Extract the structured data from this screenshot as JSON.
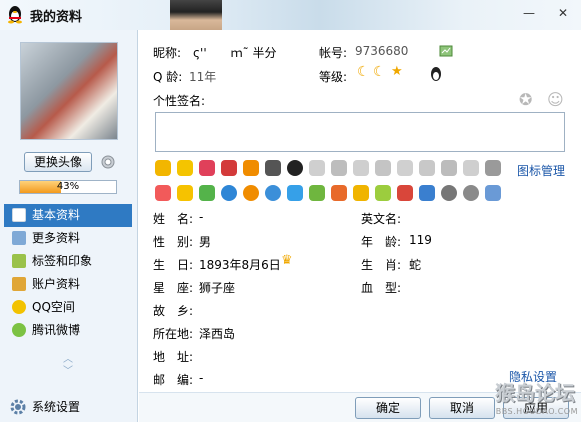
{
  "window": {
    "title": "我的资料",
    "minimize_glyph": "—",
    "close_glyph": "✕"
  },
  "profile": {
    "change_avatar_label": "更换头像",
    "completion_progress": 0.43,
    "completion_text": "43%"
  },
  "sidebar": {
    "items": [
      {
        "label": "基本资料",
        "icon": "basic-profile-icon",
        "active": true
      },
      {
        "label": "更多资料",
        "icon": "more-profile-icon",
        "active": false
      },
      {
        "label": "标签和印象",
        "icon": "tags-icon",
        "active": false
      },
      {
        "label": "账户资料",
        "icon": "account-icon",
        "active": false
      },
      {
        "label": "QQ空间",
        "icon": "qzone-icon",
        "active": false
      },
      {
        "label": "腾讯微博",
        "icon": "weibo-icon",
        "active": false
      }
    ],
    "system_settings": "系统设置"
  },
  "account": {
    "nickname_label": "昵称:",
    "nickname_value": "ς''　　ｍ˜ 半分",
    "number_label": "帐号:",
    "number_value": "9736680",
    "qage_label": "Q 龄:",
    "qage_value": "11年",
    "level_label": "等级:",
    "signature_label": "个性签名:",
    "signature_value": ""
  },
  "badges_link": "图标管理",
  "details": {
    "name_label": "姓　名:",
    "name_value": "-",
    "english_name_label": "英文名:",
    "english_name_value": "",
    "gender_label": "性　别:",
    "gender_value": "男",
    "age_label": "年　龄:",
    "age_value": "119",
    "birthday_label": "生　日:",
    "birthday_value": "1893年8月6日",
    "zodiac_label": "生　肖:",
    "zodiac_value": "蛇",
    "constellation_label": "星　座:",
    "constellation_value": "狮子座",
    "blood_label": "血　型:",
    "blood_value": "",
    "hometown_label": "故　乡:",
    "hometown_value": "",
    "location_label": "所在地:",
    "location_value": "泽西岛",
    "address_label": "地　址:",
    "address_value": "",
    "postcode_label": "邮　编:",
    "postcode_value": "-"
  },
  "privacy_link": "隐私设置",
  "buttons": {
    "ok": "确定",
    "cancel": "取消",
    "apply": "应用"
  },
  "watermark": {
    "text": "猴岛论坛",
    "sub": "BBS.HOUDAO.COM"
  },
  "colors": {
    "accent": "#2f7ac3",
    "link": "#1a56a8",
    "progress": "#f39a1d"
  }
}
